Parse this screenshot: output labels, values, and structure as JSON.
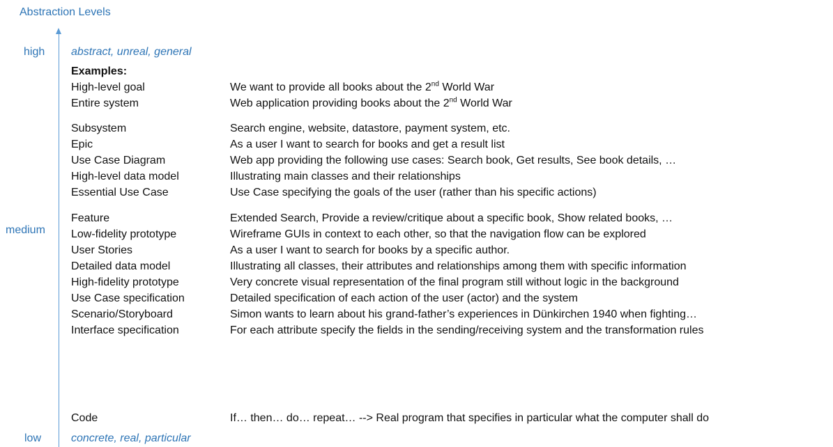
{
  "axis": {
    "title": "Abstraction Levels",
    "high_label": "high",
    "medium_label": "medium",
    "low_label": "low",
    "top_note": "abstract, unreal, general",
    "bottom_note": "concrete, real, particular"
  },
  "examples_heading": "Examples:",
  "rows": [
    {
      "term": "High-level goal",
      "desc_pre": "We want to provide all books about the 2",
      "desc_sup": "nd",
      "desc_post": " World War"
    },
    {
      "term": "Entire system",
      "desc_pre": "Web application providing books about the 2",
      "desc_sup": "nd",
      "desc_post": " World War"
    },
    {
      "term": "Subsystem",
      "desc": "Search engine, website, datastore, payment system, etc."
    },
    {
      "term": "Epic",
      "desc": "As a user I want to search for books and get a result list"
    },
    {
      "term": "Use Case Diagram",
      "desc": "Web app providing the following use cases: Search book, Get results, See book details, …"
    },
    {
      "term": "High-level data model",
      "desc": "Illustrating main classes and their relationships"
    },
    {
      "term": "Essential Use Case",
      "desc": "Use Case specifying the goals of the user (rather than his specific actions)"
    },
    {
      "term": "Feature",
      "desc": "Extended Search, Provide a review/critique about a specific book, Show related books, …"
    },
    {
      "term": "Low-fidelity prototype",
      "desc": "Wireframe GUIs in context to each other, so that the navigation flow can be explored"
    },
    {
      "term": "User Stories",
      "desc": "As a user I want to search for books by a specific author."
    },
    {
      "term": "Detailed data model",
      "desc": "Illustrating all classes, their attributes and relationships among them with specific information"
    },
    {
      "term": "High-fidelity prototype",
      "desc": "Very concrete visual representation of the final program still without logic in the background"
    },
    {
      "term": "Use Case specification",
      "desc": "Detailed specification of each action of the user (actor) and the system"
    },
    {
      "term": "Scenario/Storyboard",
      "desc": "Simon wants to learn about his grand-father’s experiences in Dünkirchen 1940 when fighting…"
    },
    {
      "term": "Interface specification",
      "desc": "For each attribute specify the fields in the sending/receiving system and the transformation rules"
    },
    {
      "term": "Code",
      "desc": "If… then… do… repeat… --> Real program that specifies in particular what the computer shall do"
    }
  ],
  "colors": {
    "accent": "#2e75b6",
    "axis_line": "#5b9bd5",
    "text": "#111111"
  }
}
